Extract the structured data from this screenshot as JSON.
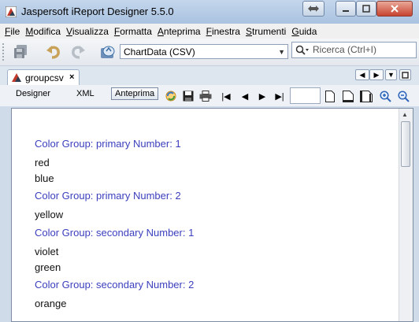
{
  "window": {
    "title": "Jaspersoft iReport Designer 5.5.0"
  },
  "menu": [
    "File",
    "Modifica",
    "Visualizza",
    "Formatta",
    "Anteprima",
    "Finestra",
    "Strumenti",
    "Guida"
  ],
  "toolbar": {
    "datasource": "ChartData (CSV)",
    "search_placeholder": "Ricerca (Ctrl+I)"
  },
  "doc_tab": {
    "label": "groupcsv"
  },
  "editor_modes": {
    "designer": "Designer",
    "xml": "XML",
    "preview": "Anteprima"
  },
  "report": {
    "lines": [
      {
        "type": "group",
        "text": "Color Group: primary Number: 1"
      },
      {
        "type": "detail",
        "text": "red"
      },
      {
        "type": "detail",
        "text": "blue"
      },
      {
        "type": "group",
        "text": "Color Group: primary Number: 2"
      },
      {
        "type": "detail",
        "text": "yellow"
      },
      {
        "type": "group",
        "text": "Color Group: secondary Number: 1"
      },
      {
        "type": "detail",
        "text": "violet"
      },
      {
        "type": "detail",
        "text": "green"
      },
      {
        "type": "group",
        "text": "Color Group: secondary Number: 2"
      },
      {
        "type": "detail",
        "text": "orange"
      }
    ]
  },
  "colors": {
    "group_header": "#3b3fbd",
    "accent": "#3a6ea5"
  }
}
